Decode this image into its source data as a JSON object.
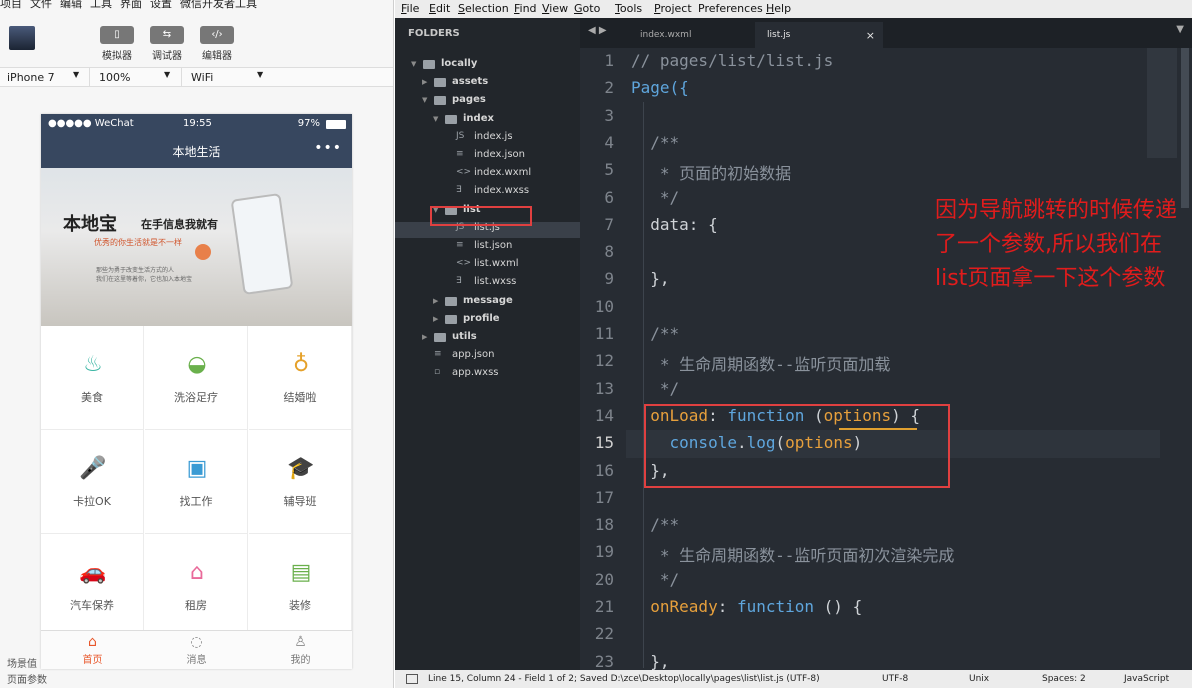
{
  "devtools": {
    "menu": [
      "项目",
      "文件",
      "编辑",
      "工具",
      "界面",
      "设置",
      "微信开发者工具"
    ],
    "toolbar": [
      {
        "label": "模拟器",
        "icon": "phone-icon"
      },
      {
        "label": "调试器",
        "icon": "debug-icon"
      },
      {
        "label": "编辑器",
        "icon": "code-icon"
      }
    ],
    "device": "iPhone 7",
    "zoom": "100%",
    "network": "WiFi",
    "bottom_labels": [
      "场景值",
      "页面参数"
    ]
  },
  "phone": {
    "status": {
      "carrier": "●●●●● WeChat",
      "time": "19:55",
      "battery": "97%"
    },
    "nav_title": "本地生活",
    "nav_more": "•••",
    "banner": {
      "title": "本地宝",
      "tagline": "在手信息我就有",
      "subline": "优秀的你生活就是不一样",
      "desc1": "那些为勇于改变生活方式的人",
      "desc2": "我们在这里等着你，它也加入本地宝"
    },
    "grid": [
      {
        "label": "美食",
        "icon": "food-cover-icon",
        "glyph": "♨",
        "color": "#3bb6a4"
      },
      {
        "label": "洗浴足疗",
        "icon": "bath-icon",
        "glyph": "◒",
        "color": "#6ab04c"
      },
      {
        "label": "结婚啦",
        "icon": "rings-icon",
        "glyph": "♁",
        "color": "#e5a12a"
      },
      {
        "label": "卡拉OK",
        "icon": "microphone-icon",
        "glyph": "🎤",
        "color": "#ef8a6a"
      },
      {
        "label": "找工作",
        "icon": "briefcase-icon",
        "glyph": "▣",
        "color": "#3a9bd4"
      },
      {
        "label": "辅导班",
        "icon": "graduation-cap-icon",
        "glyph": "🎓",
        "color": "#3a7fd4"
      },
      {
        "label": "汽车保养",
        "icon": "car-icon",
        "glyph": "🚗",
        "color": "#3a7fd4"
      },
      {
        "label": "租房",
        "icon": "house-icon",
        "glyph": "⌂",
        "color": "#e96a9a"
      },
      {
        "label": "装修",
        "icon": "paint-roller-icon",
        "glyph": "▤",
        "color": "#6ab04c"
      }
    ],
    "tabs": [
      {
        "label": "首页",
        "icon": "home-icon",
        "glyph": "⌂",
        "active": true
      },
      {
        "label": "消息",
        "icon": "message-icon",
        "glyph": "◌",
        "active": false
      },
      {
        "label": "我的",
        "icon": "user-icon",
        "glyph": "♙",
        "active": false
      }
    ]
  },
  "editor": {
    "menu": [
      {
        "u": "F",
        "rest": "ile"
      },
      {
        "u": "E",
        "rest": "dit"
      },
      {
        "u": "S",
        "rest": "election"
      },
      {
        "u": "F",
        "rest": "ind"
      },
      {
        "u": "V",
        "rest": "iew"
      },
      {
        "u": "G",
        "rest": "oto"
      },
      {
        "u": "T",
        "rest": "ools"
      },
      {
        "u": "P",
        "rest": "roject"
      },
      {
        "u": "",
        "rest": "Preferences"
      },
      {
        "u": "H",
        "rest": "elp"
      }
    ],
    "folders_header": "FOLDERS",
    "tree": [
      {
        "name": "locally",
        "type": "folder",
        "open": true,
        "depth": 0
      },
      {
        "name": "assets",
        "type": "folder",
        "open": false,
        "depth": 1
      },
      {
        "name": "pages",
        "type": "folder",
        "open": true,
        "depth": 1
      },
      {
        "name": "index",
        "type": "folder",
        "open": true,
        "depth": 2
      },
      {
        "name": "index.js",
        "type": "js",
        "depth": 3
      },
      {
        "name": "index.json",
        "type": "json",
        "depth": 3
      },
      {
        "name": "index.wxml",
        "type": "xml",
        "depth": 3
      },
      {
        "name": "index.wxss",
        "type": "css",
        "depth": 3
      },
      {
        "name": "list",
        "type": "folder",
        "open": true,
        "depth": 2
      },
      {
        "name": "list.js",
        "type": "js",
        "depth": 3,
        "selected": true
      },
      {
        "name": "list.json",
        "type": "json",
        "depth": 3
      },
      {
        "name": "list.wxml",
        "type": "xml",
        "depth": 3
      },
      {
        "name": "list.wxss",
        "type": "css",
        "depth": 3
      },
      {
        "name": "message",
        "type": "folder",
        "open": false,
        "depth": 2
      },
      {
        "name": "profile",
        "type": "folder",
        "open": false,
        "depth": 2
      },
      {
        "name": "utils",
        "type": "folder",
        "open": false,
        "depth": 1
      },
      {
        "name": "app.json",
        "type": "json",
        "depth": 1
      },
      {
        "name": "app.wxss",
        "type": "file",
        "depth": 1
      }
    ],
    "tabs": [
      {
        "label": "index.wxml",
        "active": false
      },
      {
        "label": "list.js",
        "active": true,
        "close": "×"
      }
    ],
    "nav_arrows": "◀ ▶",
    "tab_dropdown": "▼",
    "current_line": 15,
    "lines": [
      {
        "n": "1",
        "text": "// pages/list/list.js",
        "c": "#8a929c"
      },
      {
        "n": "2",
        "text": "Page({",
        "c": "#5fa6dd"
      },
      {
        "n": "3",
        "text": "",
        "c": "#cfd3d7"
      },
      {
        "n": "4",
        "text": "  /**",
        "c": "#8a929c"
      },
      {
        "n": "5",
        "text": "   * 页面的初始数据",
        "c": "#8a929c"
      },
      {
        "n": "6",
        "text": "   */",
        "c": "#8a929c"
      },
      {
        "n": "7",
        "text": "  data: {",
        "c": "#cfd3d7"
      },
      {
        "n": "8",
        "text": "",
        "c": "#cfd3d7"
      },
      {
        "n": "9",
        "text": "  },",
        "c": "#cfd3d7"
      },
      {
        "n": "10",
        "text": "",
        "c": "#cfd3d7"
      },
      {
        "n": "11",
        "text": "  /**",
        "c": "#8a929c"
      },
      {
        "n": "12",
        "text": "   * 生命周期函数--监听页面加载",
        "c": "#8a929c"
      },
      {
        "n": "13",
        "text": "   */",
        "c": "#8a929c"
      },
      {
        "n": "14",
        "text": "  onLoad: function (options) {",
        "c": "#cfd3d7"
      },
      {
        "n": "15",
        "text": "    console.log(options)",
        "c": "#cfd3d7"
      },
      {
        "n": "16",
        "text": "  },",
        "c": "#cfd3d7"
      },
      {
        "n": "17",
        "text": "",
        "c": "#cfd3d7"
      },
      {
        "n": "18",
        "text": "  /**",
        "c": "#8a929c"
      },
      {
        "n": "19",
        "text": "   * 生命周期函数--监听页面初次渲染完成",
        "c": "#8a929c"
      },
      {
        "n": "20",
        "text": "   */",
        "c": "#8a929c"
      },
      {
        "n": "21",
        "text": "  onReady: function () {",
        "c": "#cfd3d7"
      },
      {
        "n": "22",
        "text": "",
        "c": "#cfd3d7"
      },
      {
        "n": "23",
        "text": "  },",
        "c": "#cfd3d7"
      }
    ],
    "annotation": "因为导航跳转的时候传递了一个参数,所以我们在list页面拿一下这个参数",
    "statusbar": {
      "position": "Line 15, Column 24 - Field 1 of 2; Saved D:\\zce\\Desktop\\locally\\pages\\list\\list.js (UTF-8)",
      "encoding": "UTF-8",
      "line_endings": "Unix",
      "indent": "Spaces: 2",
      "syntax": "JavaScript"
    },
    "colors": {
      "keyword": "#5fa6dd",
      "function_name": "#e7a03c",
      "param": "#e7a03c",
      "annotation": "#e11c1c"
    }
  }
}
